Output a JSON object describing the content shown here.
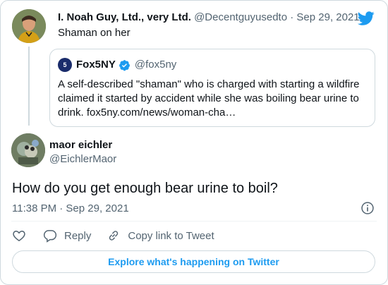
{
  "parent": {
    "name": "I. Noah Guy, Ltd., very Ltd.",
    "handle": "@Decentguyusedto",
    "separator": "·",
    "date": "Sep 29, 2021",
    "text": "Shaman on her"
  },
  "quote": {
    "logo_text": "5",
    "name": "Fox5NY",
    "handle": "@fox5ny",
    "text": "A self-described \"shaman\" who is charged with starting a wildfire claimed it started by accident while she was boiling bear urine to drink.  fox5ny.com/news/woman-cha…"
  },
  "main": {
    "name": "maor eichler",
    "handle": "@EichlerMaor",
    "text": "How do you get enough bear urine to boil?",
    "timestamp": "11:38 PM · Sep 29, 2021"
  },
  "actions": {
    "reply_label": "Reply",
    "copy_label": "Copy link to Tweet"
  },
  "footer": {
    "explore_label": "Explore what's happening on Twitter"
  },
  "colors": {
    "accent": "#1d9bf0",
    "text": "#0f1419",
    "muted": "#536471",
    "border": "#cfd9de"
  },
  "icons": [
    "twitter-logo-icon",
    "verified-icon",
    "info-icon",
    "heart-icon",
    "reply-icon",
    "link-icon"
  ]
}
